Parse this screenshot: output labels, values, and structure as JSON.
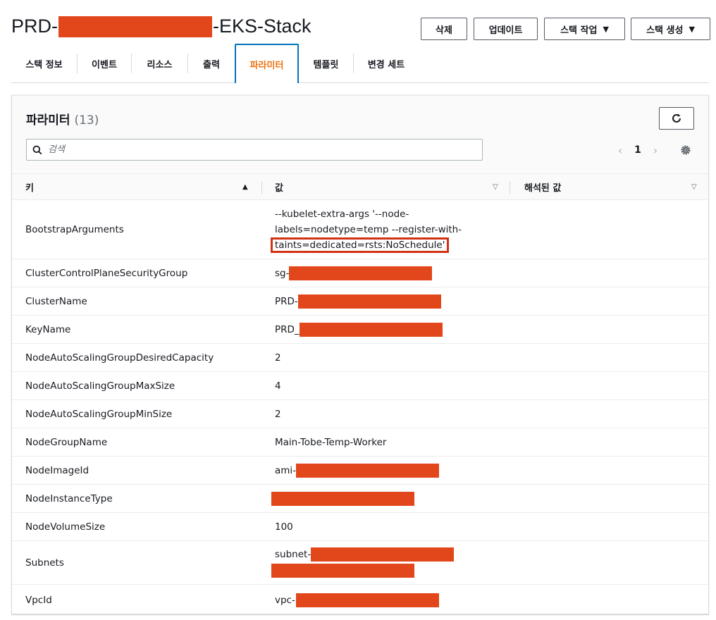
{
  "header": {
    "title_prefix": "PRD-",
    "title_suffix": "-EKS-Stack",
    "buttons": {
      "delete": "삭제",
      "update": "업데이트",
      "stack_actions": "스택 작업",
      "create_stack": "스택 생성"
    }
  },
  "tabs": [
    {
      "label": "스택 정보",
      "active": false
    },
    {
      "label": "이벤트",
      "active": false
    },
    {
      "label": "리소스",
      "active": false
    },
    {
      "label": "출력",
      "active": false
    },
    {
      "label": "파라미터",
      "active": true
    },
    {
      "label": "템플릿",
      "active": false
    },
    {
      "label": "변경 세트",
      "active": false
    }
  ],
  "panel": {
    "title": "파라미터",
    "count": "(13)",
    "search_placeholder": "검색",
    "page": "1"
  },
  "columns": {
    "key": "키",
    "value": "값",
    "resolved": "해석된 값"
  },
  "rows": [
    {
      "key": "BootstrapArguments",
      "value_line1": "--kubelet-extra-args '--node-",
      "value_line2": "labels=nodetype=temp --register-with-",
      "value_line3": "taints=dedicated=rsts:NoSchedule'"
    },
    {
      "key": "ClusterControlPlaneSecurityGroup",
      "value": "sg-"
    },
    {
      "key": "ClusterName",
      "value": "PRD-"
    },
    {
      "key": "KeyName",
      "value": "PRD_"
    },
    {
      "key": "NodeAutoScalingGroupDesiredCapacity",
      "value": "2"
    },
    {
      "key": "NodeAutoScalingGroupMaxSize",
      "value": "4"
    },
    {
      "key": "NodeAutoScalingGroupMinSize",
      "value": "2"
    },
    {
      "key": "NodeGroupName",
      "value": "Main-Tobe-Temp-Worker"
    },
    {
      "key": "NodeImageId",
      "value": "ami-"
    },
    {
      "key": "NodeInstanceType",
      "value": ""
    },
    {
      "key": "NodeVolumeSize",
      "value": "100"
    },
    {
      "key": "Subnets",
      "value": "subnet-"
    },
    {
      "key": "VpcId",
      "value": "vpc-("
    }
  ],
  "colors": {
    "redaction": "#e2471b",
    "active_tab_text": "#ec7211",
    "active_tab_border": "#0073bb",
    "highlight_box": "#d13212"
  }
}
